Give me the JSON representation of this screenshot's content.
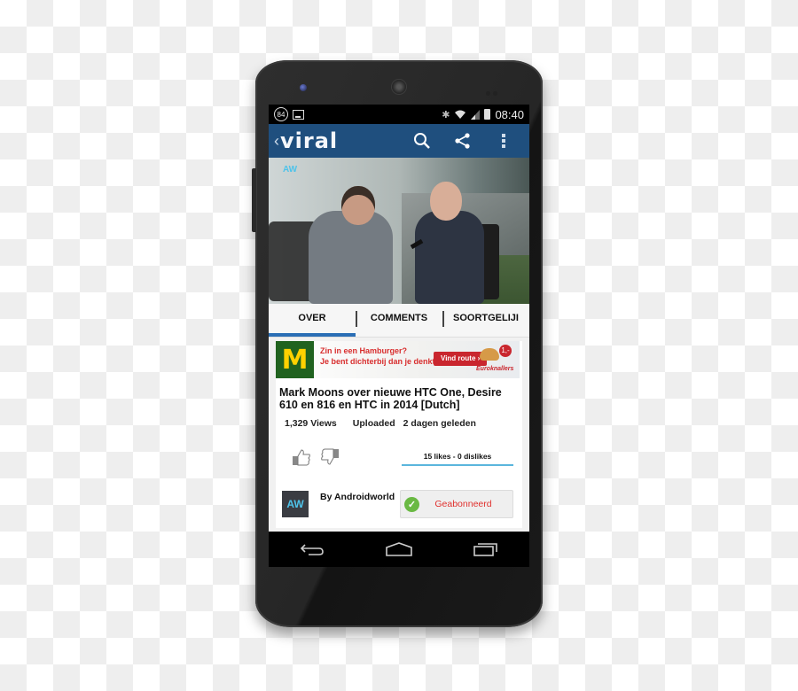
{
  "status_bar": {
    "notification_count": "84",
    "icons": [
      "counter-badge-icon",
      "image-icon",
      "bluetooth-icon",
      "wifi-icon",
      "signal-icon",
      "battery-icon"
    ],
    "time": "08:40"
  },
  "app_bar": {
    "back_glyph": "‹",
    "logo": "viral",
    "actions": [
      "search-icon",
      "share-icon",
      "overflow-menu-icon"
    ],
    "color": "#1f4f7e"
  },
  "video": {
    "watermark": "AW"
  },
  "tabs": [
    {
      "label": "OVER",
      "active": true
    },
    {
      "label": "COMMENTS",
      "active": false
    },
    {
      "label": "SOORTGELIJI",
      "active": false
    }
  ],
  "ad": {
    "brand": "M",
    "headline": "Zin in een Hamburger?",
    "subline": "Je bent dichterbij dan je denkt...",
    "button": "Vind route ›",
    "price": "1,-",
    "tagline": "Euroknallers"
  },
  "video_info": {
    "title": "Mark Moons over nieuwe HTC One, Desire 610 en 816 en HTC in 2014 [Dutch]",
    "views": "1,329 Views",
    "uploaded_label": "Uploaded",
    "uploaded_value": "2 dagen geleden",
    "likes_summary": "15 likes - 0 dislikes"
  },
  "channel": {
    "logo_text": "AW",
    "by": "By Androidworld",
    "subscribe_label": "Geabonneerd",
    "subscribed": true
  },
  "nav_bar": [
    "back-icon",
    "home-icon",
    "recents-icon"
  ],
  "colors": {
    "accent": "#2a6eb5",
    "likes_bar": "#5ab6dd",
    "subscribe_text": "#e0312e",
    "check": "#6ab943"
  }
}
